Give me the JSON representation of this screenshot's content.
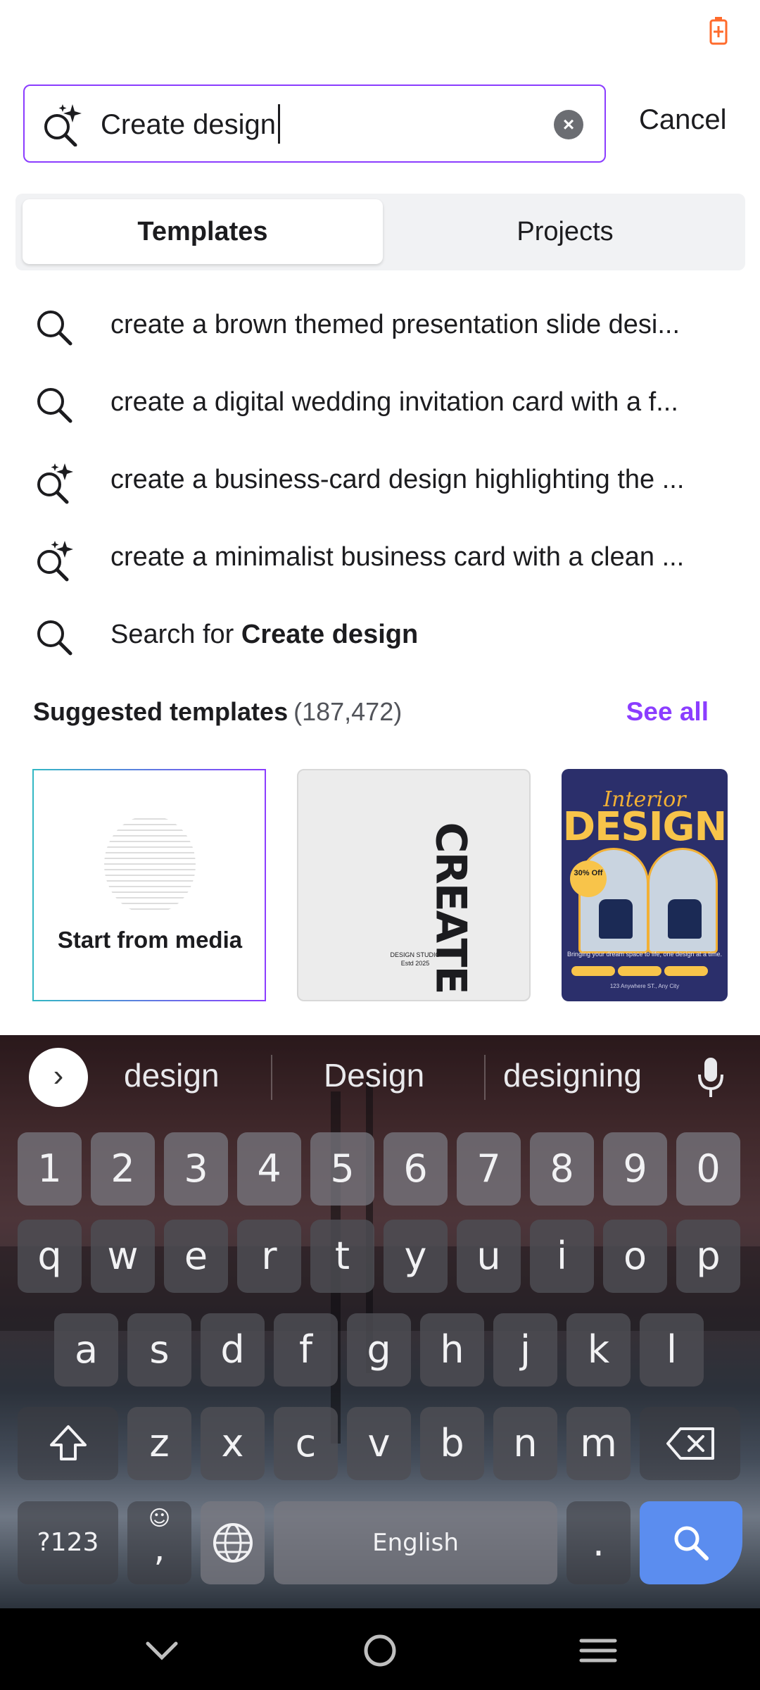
{
  "status": {
    "battery_icon": "battery-charging-icon"
  },
  "search": {
    "value": "Create design",
    "placeholder": "",
    "cancel_label": "Cancel"
  },
  "tabs": [
    {
      "label": "Templates"
    },
    {
      "label": "Projects"
    }
  ],
  "suggestions": [
    {
      "text": "create a brown themed presentation slide desi...",
      "icon": "search-icon"
    },
    {
      "text": "create a digital wedding invitation card with a f...",
      "icon": "search-icon"
    },
    {
      "text": "create a business-card design highlighting the ...",
      "icon": "magic-search-icon"
    },
    {
      "text": "create a minimalist business card with a clean ...",
      "icon": "magic-search-icon"
    }
  ],
  "search_for": {
    "prefix": "Search for ",
    "query": "Create design"
  },
  "suggested_templates": {
    "title": "Suggested templates",
    "count": "(187,472)",
    "see_all": "See all",
    "cards": [
      {
        "label": "Start from media"
      },
      {
        "word": "CREATE",
        "sub1": "DESIGN STUDIO",
        "sub2": "Estd 2025"
      },
      {
        "title1": "Interior",
        "title2": "DESIGN",
        "badge": "30% Off",
        "tagline": "Bringing your dream space to life, one design at a time.",
        "footer": "123 Anywhere ST., Any City"
      }
    ]
  },
  "keyboard": {
    "word_suggestions": [
      "design",
      "Design",
      "designing"
    ],
    "rows": [
      [
        "1",
        "2",
        "3",
        "4",
        "5",
        "6",
        "7",
        "8",
        "9",
        "0"
      ],
      [
        "q",
        "w",
        "e",
        "r",
        "t",
        "y",
        "u",
        "i",
        "o",
        "p"
      ],
      [
        "a",
        "s",
        "d",
        "f",
        "g",
        "h",
        "j",
        "k",
        "l"
      ],
      [
        "z",
        "x",
        "c",
        "v",
        "b",
        "n",
        "m"
      ]
    ],
    "symbols_label": "?123",
    "comma_label": ",",
    "space_label": "English",
    "period_label": "."
  },
  "colors": {
    "accent": "#8b3dff",
    "search_key": "#5b8def",
    "battery": "#ff6b2c"
  }
}
